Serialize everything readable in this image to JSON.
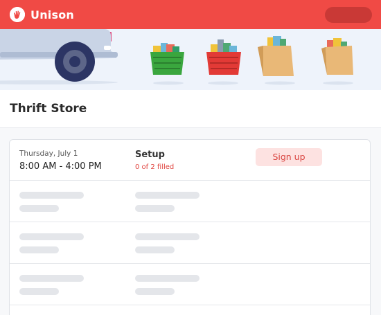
{
  "app": {
    "brand_name": "Unison"
  },
  "page": {
    "title": "Thrift Store"
  },
  "shift": {
    "date": "Thursday, July 1",
    "time": "8:00 AM - 4:00 PM",
    "role": "Setup",
    "status": "0 of 2 filled",
    "action_label": "Sign up"
  },
  "colors": {
    "brand_red": "#f04a45",
    "banner_bg": "#eef3fb",
    "status_red": "#e0443f",
    "signup_bg": "#fde2e1",
    "placeholder_gray": "#e4e6ea"
  },
  "banner_items": [
    "green-basket-icon",
    "red-basket-icon",
    "grocery-bag-icon",
    "grocery-bag-icon"
  ],
  "placeholder_rows": 3
}
